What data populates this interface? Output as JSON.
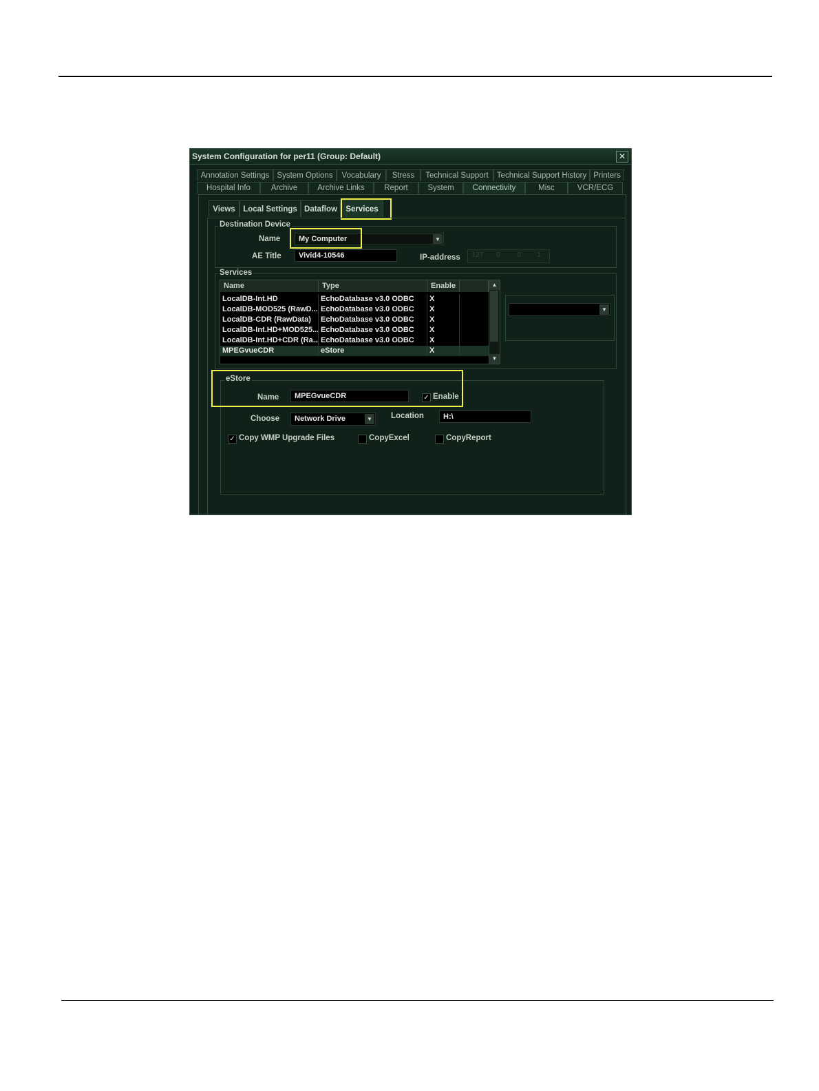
{
  "window": {
    "title": "System Configuration for per11 (Group: Default)",
    "close": "✕"
  },
  "tabs_row1": [
    "Annotation Settings",
    "System Options",
    "Vocabulary",
    "Stress",
    "Technical Support",
    "Technical Support History",
    "Printers"
  ],
  "tabs_row2": [
    "Hospital Info",
    "Archive",
    "Archive Links",
    "Report",
    "System",
    "Connectivity",
    "Misc",
    "VCR/ECG"
  ],
  "subtabs": [
    "Views",
    "Local Settings",
    "Dataflow",
    "Services"
  ],
  "destination": {
    "group_label": "Destination Device",
    "name_label": "Name",
    "name_value": "My Computer",
    "ae_label": "AE Title",
    "ae_value": "Vivid4-10546",
    "ip_label": "IP-address",
    "ip_segments": [
      "127",
      "0",
      "0",
      "1"
    ]
  },
  "services": {
    "group_label": "Services",
    "columns": [
      "Name",
      "Type",
      "Enable"
    ],
    "rows": [
      {
        "name": "LocalDB-Int.HD",
        "type": "EchoDatabase v3.0 ODBC",
        "enable": "X"
      },
      {
        "name": "LocalDB-MOD525 (RawD...",
        "type": "EchoDatabase v3.0 ODBC",
        "enable": "X"
      },
      {
        "name": "LocalDB-CDR (RawData)",
        "type": "EchoDatabase v3.0 ODBC",
        "enable": "X"
      },
      {
        "name": "LocalDB-Int.HD+MOD525...",
        "type": "EchoDatabase v3.0 ODBC",
        "enable": "X"
      },
      {
        "name": "LocalDB-Int.HD+CDR (Ra...",
        "type": "EchoDatabase v3.0 ODBC",
        "enable": "X"
      },
      {
        "name": "MPEGvueCDR",
        "type": "eStore",
        "enable": "X"
      }
    ]
  },
  "estore": {
    "group_label": "eStore",
    "name_label": "Name",
    "name_value": "MPEGvueCDR",
    "enable_label": "Enable",
    "enable_checked": "✓",
    "choose_label": "Choose",
    "choose_value": "Network Drive",
    "location_label": "Location",
    "location_value": "H:\\",
    "copy_wmp_label": "Copy WMP Upgrade Files",
    "copy_wmp_checked": "✓",
    "copy_excel_label": "CopyExcel",
    "copy_report_label": "CopyReport"
  },
  "icons": {
    "dropdown": "▼",
    "scroll_up": "▲",
    "scroll_down": "▼"
  },
  "colors": {
    "highlight": "#f2f04a",
    "window_bg": "#0f2118"
  }
}
